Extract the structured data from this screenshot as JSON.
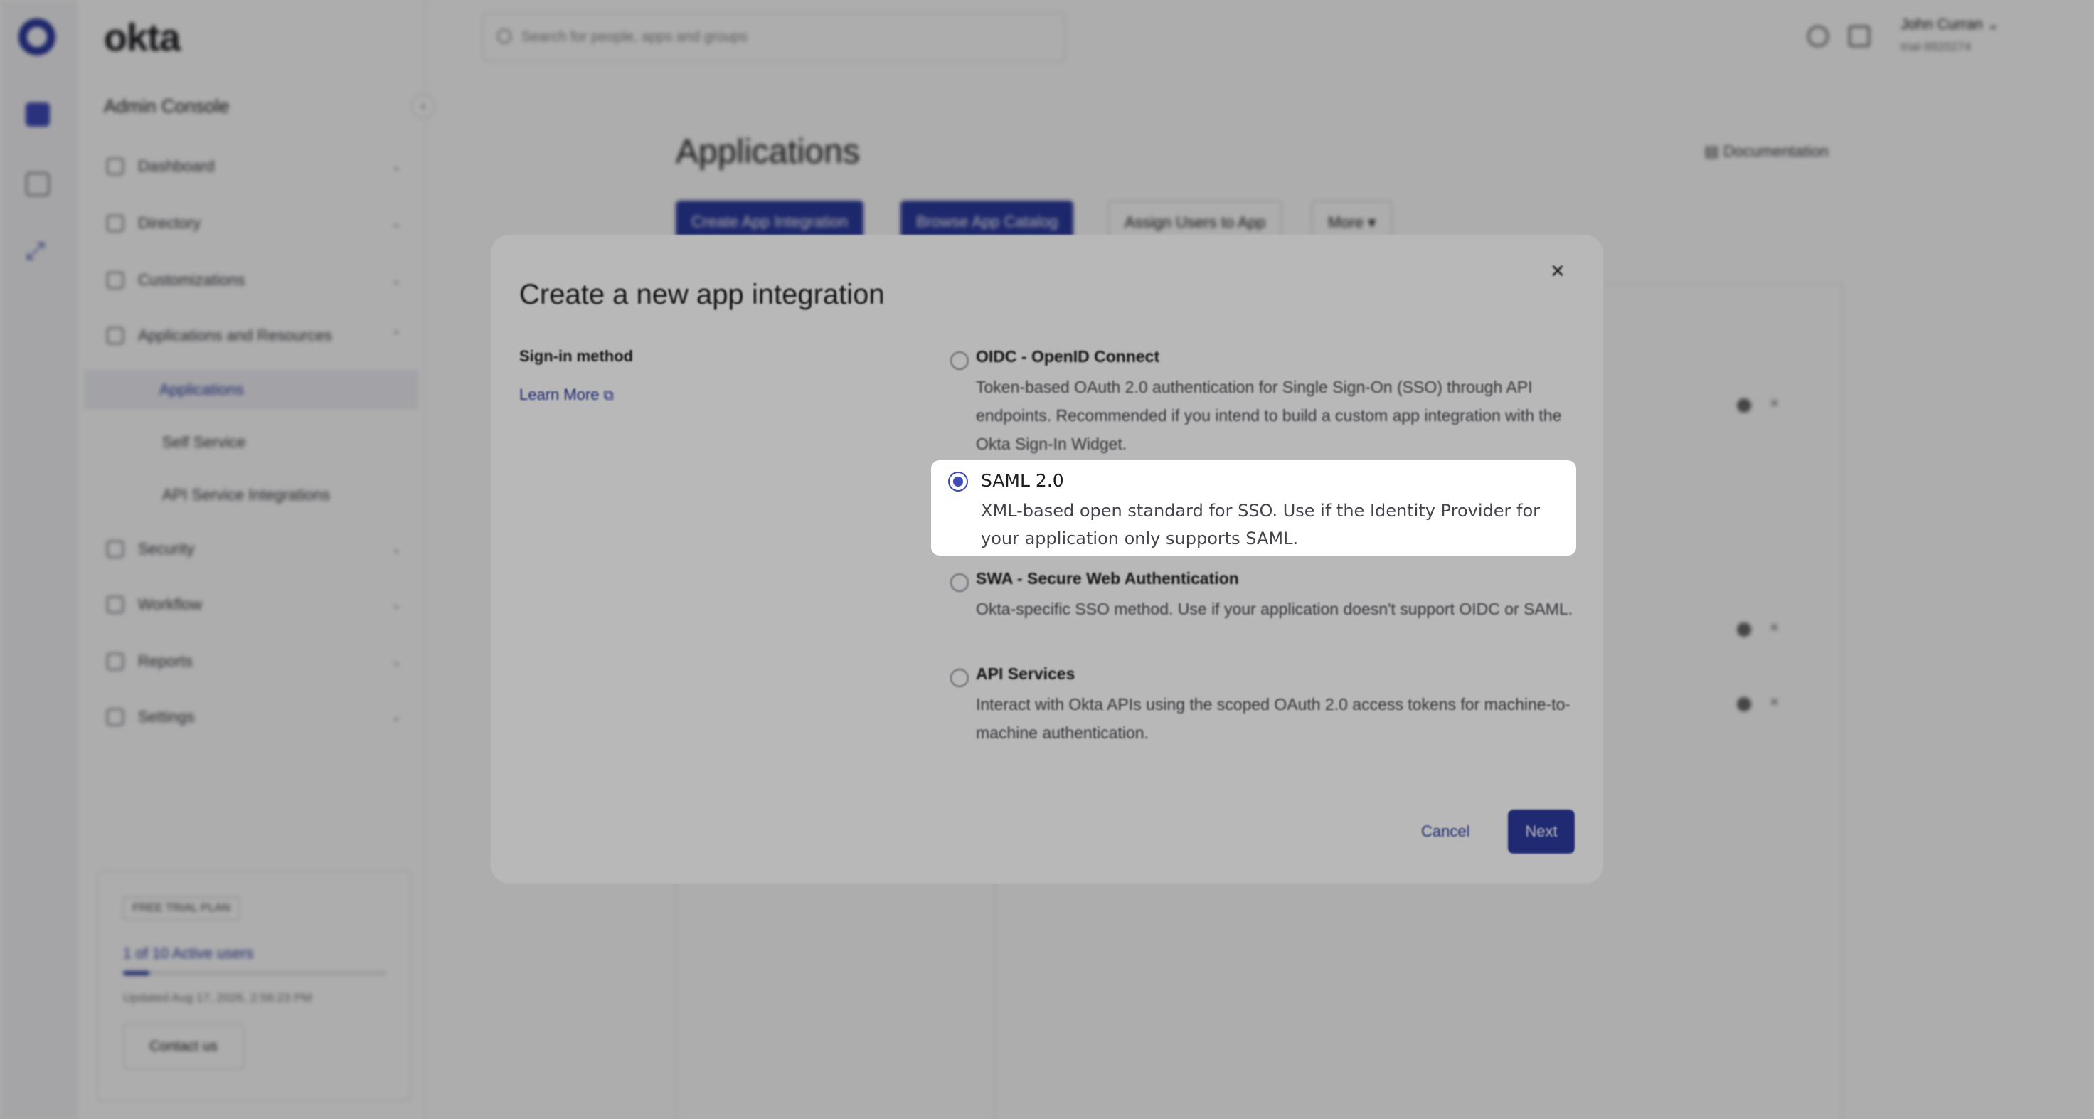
{
  "app": {
    "brand": "okta",
    "console_title": "Admin Console",
    "search_placeholder": "Search for people, apps and groups",
    "user_name": "John Curran",
    "org_name": "trial-9920274"
  },
  "sidebar": {
    "items": [
      {
        "label": "Dashboard"
      },
      {
        "label": "Directory"
      },
      {
        "label": "Customizations"
      },
      {
        "label": "Applications and Resources"
      },
      {
        "label": "Security"
      },
      {
        "label": "Workflow"
      },
      {
        "label": "Reports"
      },
      {
        "label": "Settings"
      }
    ],
    "sub_items": [
      {
        "label": "Applications"
      },
      {
        "label": "Self Service"
      },
      {
        "label": "API Service Integrations"
      }
    ],
    "trial": {
      "badge": "FREE TRIAL PLAN",
      "users": "1 of 10 Active users",
      "usage_fraction": 0.1,
      "updated": "Updated Aug 17, 2026, 2:58:23 PM",
      "contact": "Contact us"
    }
  },
  "page": {
    "title": "Applications",
    "documentation": "Documentation",
    "buttons": {
      "create": "Create App Integration",
      "browse": "Browse App Catalog",
      "assign": "Assign Users to App",
      "more": "More ▾"
    }
  },
  "modal": {
    "title": "Create a new app integration",
    "close": "×",
    "sign_in_label": "Sign-in method",
    "learn_more": "Learn More",
    "options": [
      {
        "title": "OIDC - OpenID Connect",
        "desc": "Token-based OAuth 2.0 authentication for Single Sign-On (SSO) through API endpoints. Recommended if you intend to build a custom app integration with the Okta Sign-In Widget.",
        "selected": false
      },
      {
        "title": "SAML 2.0",
        "desc": "XML-based open standard for SSO. Use if the Identity Provider for your application only supports SAML.",
        "selected": true
      },
      {
        "title": "SWA - Secure Web Authentication",
        "desc": "Okta-specific SSO method. Use if your application doesn't support OIDC or SAML.",
        "selected": false
      },
      {
        "title": "API Services",
        "desc": "Interact with Okta APIs using the scoped OAuth 2.0 access tokens for machine-to-machine authentication.",
        "selected": false
      }
    ],
    "cancel": "Cancel",
    "next": "Next"
  },
  "colors": {
    "accent": "#3f4bb8",
    "primary_button": "#2c3a9e",
    "overlay": "rgba(0,0,0,0.32)"
  }
}
